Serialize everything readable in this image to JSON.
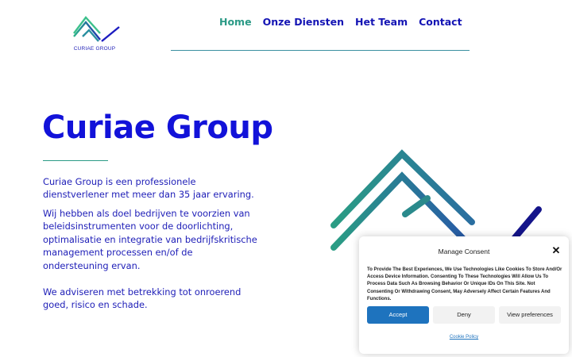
{
  "header": {
    "logo_text": "CURIAE GROUP",
    "nav": [
      {
        "label": "Home",
        "active": true
      },
      {
        "label": "Onze Diensten",
        "active": false
      },
      {
        "label": "Het Team",
        "active": false
      },
      {
        "label": "Contact",
        "active": false
      }
    ]
  },
  "hero": {
    "title": "Curiae Group",
    "paragraph1": "Curiae Group is een professionele dienstverlener met meer dan 35 jaar ervaring.",
    "paragraph2": "Wij hebben als doel bedrijven te voorzien van beleidsinstrumenten voor de doorlichting, optimalisatie en integratie van bedrijfskritische management processen en/of de ondersteuning ervan.",
    "paragraph3": "We adviseren met betrekking tot onroerend goed, risico en schade."
  },
  "consent": {
    "title": "Manage Consent",
    "close": "✕",
    "body": "To Provide The Best Experiences, We Use Technologies Like Cookies To Store And/Or Access Device Information. Consenting To These Technologies Will Allow Us To Process Data Such As Browsing Behavior Or Unique IDs On This Site. Not Consenting Or Withdrawing Consent, May Adversely Affect Certain Features And Functions.",
    "accept_label": "Accept",
    "deny_label": "Deny",
    "preferences_label": "View preferences",
    "policy_label": "Cookie Policy"
  },
  "colors": {
    "brand_blue": "#1212d9",
    "brand_teal": "#2b9a86",
    "accept_blue": "#1e73be"
  },
  "icons": {
    "logo": "chevron-mark-logo",
    "close": "close-icon"
  }
}
